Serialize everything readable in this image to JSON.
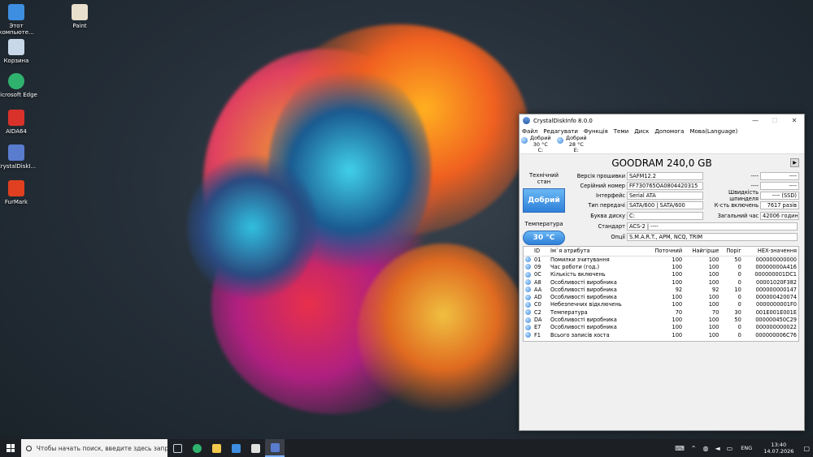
{
  "desktop": {
    "icons": [
      {
        "label": "Этот компьюте...",
        "icon": "this-pc-icon",
        "color": "#3d8ee0"
      },
      {
        "label": "Paint",
        "icon": "paint-icon",
        "color": "#e8e0cc"
      },
      {
        "label": "Корзина",
        "icon": "recycle-bin-icon",
        "color": "#c8d8e8"
      },
      {
        "label": "Microsoft Edge",
        "icon": "edge-icon",
        "color": "#2fb26e"
      },
      {
        "label": "AIDA64",
        "icon": "aida64-icon",
        "color": "#d8322a"
      },
      {
        "label": "CrystalDiskI...",
        "icon": "crystaldiskinfo-icon",
        "color": "#5a7ccf"
      },
      {
        "label": "FurMark",
        "icon": "furmark-icon",
        "color": "#e04020"
      }
    ]
  },
  "window": {
    "title": "CrystalDiskInfo 8.0.0",
    "controls": {
      "minimize": "—",
      "maximize": "☐",
      "close": "✕"
    },
    "menu": [
      "Файл",
      "Редагувати",
      "Функція",
      "Теми",
      "Диск",
      "Допомога",
      "Мова(Language)"
    ],
    "drives": [
      {
        "status": "Добрий",
        "temp": "30 °C",
        "letter": "C:"
      },
      {
        "status": "Добрий",
        "temp": "28 °C",
        "letter": "E:"
      }
    ],
    "model": "GOODRAM 240,0 GB",
    "next_label": "▶",
    "health_label": "Технічний стан",
    "health_value": "Добрий",
    "temp_label": "Температура",
    "temp_value": "30 °C",
    "fields": {
      "firmware": {
        "label": "Версія прошивки",
        "value": "SAFM12.2"
      },
      "serial": {
        "label": "Серійний номер",
        "value": "FF730765OA0804420315"
      },
      "interface": {
        "label": "Інтерфейс",
        "value": "Serial ATA"
      },
      "transfer": {
        "label": "Тип передачі",
        "value": "SATA/600 | SATA/600"
      },
      "drive_letter": {
        "label": "Буква диску",
        "value": "C:"
      },
      "standard": {
        "label": "Стандарт",
        "value": "ACS-2 | ----"
      },
      "features": {
        "label": "Опції",
        "value": "S.M.A.R.T., APM, NCQ, TRIM"
      },
      "right_top1": {
        "label": "----",
        "value": "----"
      },
      "right_top2": {
        "label": "----",
        "value": "----"
      },
      "rotation": {
        "label": "Швидкість шпинделя",
        "value": "---- (SSD)"
      },
      "power_count": {
        "label": "К-сть включень",
        "value": "7617 разів"
      },
      "power_hours": {
        "label": "Загальний час",
        "value": "42006 годин"
      }
    },
    "smart": {
      "headers": [
        "ID",
        "Ім`я атрибута",
        "Поточний",
        "Найгірше",
        "Поріг",
        "HEX-значення"
      ],
      "rows": [
        [
          "01",
          "Помилки зчитування",
          "100",
          "100",
          "50",
          "000000000000"
        ],
        [
          "09",
          "Час роботи (год.)",
          "100",
          "100",
          "0",
          "00000000A416"
        ],
        [
          "0C",
          "Кількість включень",
          "100",
          "100",
          "0",
          "000000001DC1"
        ],
        [
          "A8",
          "Особливості виробника",
          "100",
          "100",
          "0",
          "00001020F382"
        ],
        [
          "AA",
          "Особливості виробника",
          "92",
          "92",
          "10",
          "000000000147"
        ],
        [
          "AD",
          "Особливості виробника",
          "100",
          "100",
          "0",
          "000000420074"
        ],
        [
          "C0",
          "Небезпечних відключень",
          "100",
          "100",
          "0",
          "0000000001F0"
        ],
        [
          "C2",
          "Температура",
          "70",
          "70",
          "30",
          "001E001E001E"
        ],
        [
          "DA",
          "Особливості виробника",
          "100",
          "100",
          "50",
          "000000450C29"
        ],
        [
          "E7",
          "Особливості виробника",
          "100",
          "100",
          "0",
          "000000000022"
        ],
        [
          "F1",
          "Всього записів хоста",
          "100",
          "100",
          "0",
          "000000006C76"
        ]
      ]
    }
  },
  "taskbar": {
    "search_placeholder": "Чтобы начать поиск, введите здесь запрос",
    "pinned": [
      {
        "icon": "task-view-icon",
        "color": "#cfd8e0"
      },
      {
        "icon": "edge-icon",
        "color": "#2fb26e"
      },
      {
        "icon": "file-explorer-icon",
        "color": "#f2c94c"
      },
      {
        "icon": "store-icon",
        "color": "#3d8ee0"
      },
      {
        "icon": "mail-icon",
        "color": "#e0e0e0"
      },
      {
        "icon": "crystaldiskinfo-icon",
        "color": "#5a7ccf"
      }
    ],
    "language": "ENG",
    "time": "13:40",
    "date": "14.07.2026"
  }
}
